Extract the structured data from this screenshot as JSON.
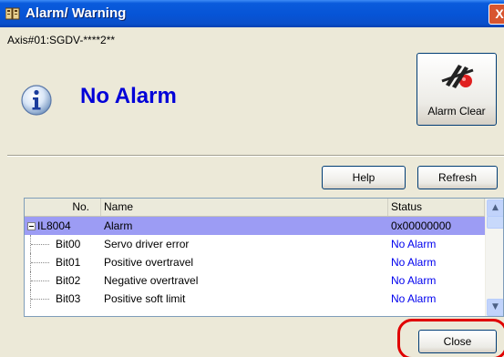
{
  "window": {
    "title": "Alarm/ Warning",
    "close_glyph": "X",
    "icon_name": "servo-pack-icon"
  },
  "axis": {
    "label": "Axis#01:SGDV-****2**"
  },
  "alarm": {
    "status_text": "No Alarm",
    "status_color": "#0000d8",
    "icon_name": "info-icon"
  },
  "alarm_clear": {
    "label": "Alarm Clear",
    "icon_name": "alarm-clear-icon"
  },
  "buttons": {
    "help": "Help",
    "refresh": "Refresh",
    "close": "Close"
  },
  "table": {
    "columns": [
      "No.",
      "Name",
      "Status"
    ],
    "group": {
      "expander": "−",
      "no": "IL8004",
      "name": "Alarm",
      "status": "0x00000000"
    },
    "rows": [
      {
        "no": "Bit00",
        "name": "Servo driver error",
        "status": "No Alarm"
      },
      {
        "no": "Bit01",
        "name": "Positive overtravel",
        "status": "No Alarm"
      },
      {
        "no": "Bit02",
        "name": "Negative overtravel",
        "status": "No Alarm"
      },
      {
        "no": "Bit03",
        "name": "Positive soft limit",
        "status": "No Alarm"
      }
    ],
    "scroll_up_glyph": "▲",
    "scroll_down_glyph": "▼"
  },
  "colors": {
    "titlebar": "#0654d6",
    "window_bg": "#ece9d8",
    "selected_row": "#9c9cf4",
    "status_link": "#0000ee",
    "highlight_ring": "#e00000"
  }
}
